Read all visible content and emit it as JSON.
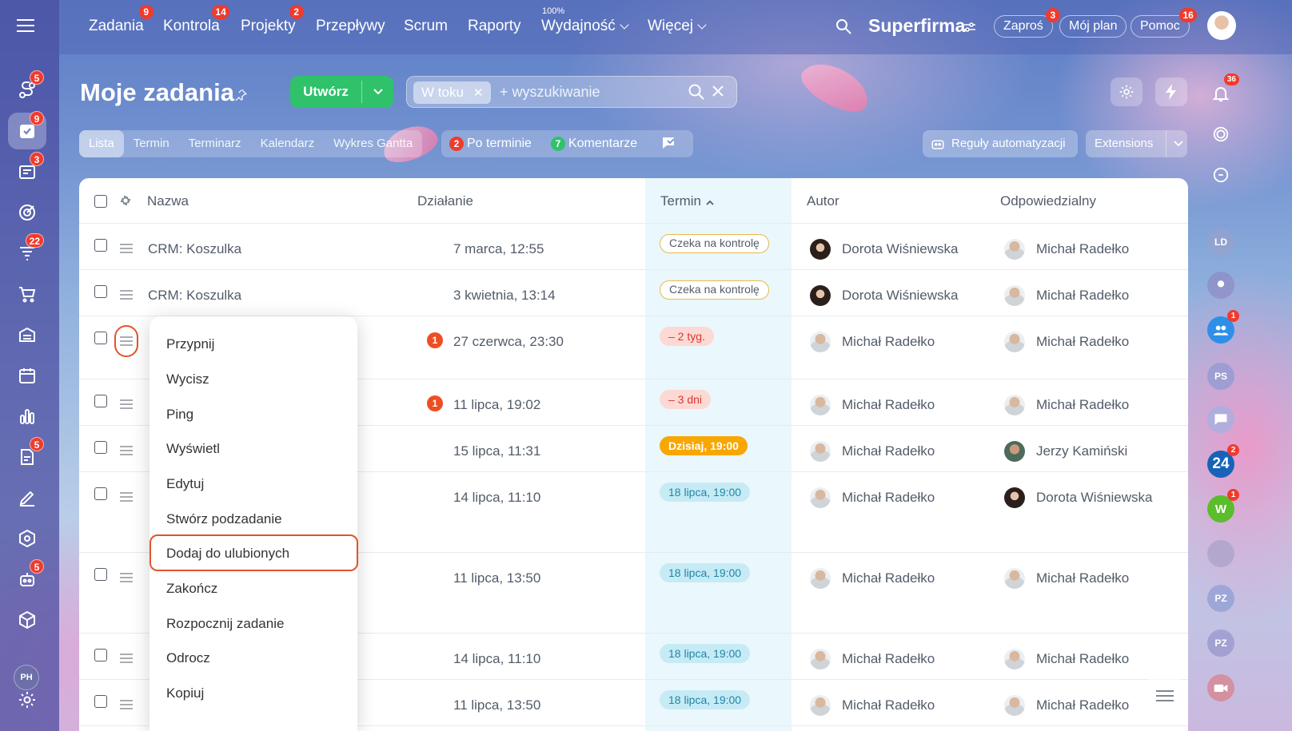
{
  "topnav": {
    "items": [
      {
        "label": "Zadania",
        "badge": "9"
      },
      {
        "label": "Kontrola",
        "badge": "14"
      },
      {
        "label": "Projekty",
        "badge": "2"
      },
      {
        "label": "Przepływy",
        "badge": ""
      },
      {
        "label": "Scrum",
        "badge": ""
      },
      {
        "label": "Raporty",
        "badge": ""
      },
      {
        "label": "Wydajność",
        "badge": "",
        "sup": "100%"
      },
      {
        "label": "Więcej",
        "badge": ""
      }
    ],
    "brand": "Superfirma",
    "invite": {
      "label": "Zaproś",
      "badge": "3"
    },
    "my_plan": "Mój plan",
    "help": {
      "label": "Pomoc",
      "badge": "16"
    }
  },
  "leftbar": {
    "badges": {
      "flows": "5",
      "tasks": "9",
      "feed": "3",
      "crm": "22",
      "docs": "5",
      "robot": "5"
    },
    "avatar_initials": "PH"
  },
  "rightbar": {
    "bell_badge": "36",
    "items": [
      {
        "initials": "LD"
      },
      {
        "initials": "",
        "badge": ""
      },
      {
        "initials": "",
        "badge": "1"
      },
      {
        "initials": "PS"
      },
      {
        "initials": ""
      },
      {
        "initials": "24",
        "badge": "2"
      },
      {
        "initials": "W",
        "badge": "1"
      },
      {
        "initials": ""
      },
      {
        "initials": "PZ"
      },
      {
        "initials": "PZ"
      }
    ]
  },
  "page": {
    "title": "Moje zadania",
    "create_label": "Utwórz",
    "filter_chip": "W toku",
    "search_placeholder": "+ wyszukiwanie"
  },
  "views": {
    "tabs": [
      "Lista",
      "Termin",
      "Terminarz",
      "Kalendarz",
      "Wykres Gantta"
    ],
    "active": "Lista",
    "overdue": {
      "count": "2",
      "label": "Po terminie"
    },
    "comments": {
      "count": "7",
      "label": "Komentarze"
    },
    "automation_label": "Reguły automatyzacji",
    "extensions_label": "Extensions"
  },
  "colors": {
    "create_green": "#2fc26a",
    "highlight_orange": "#e2542c",
    "overdue_red": "#d9372c",
    "today_orange": "#f7a700",
    "future_blue": "#1f86a8"
  },
  "table": {
    "headers": {
      "name": "Nazwa",
      "action": "Działanie",
      "deadline": "Termin",
      "author": "Autor",
      "responsible": "Odpowiedzialny"
    },
    "rows": [
      {
        "name": "CRM: Koszulka",
        "action_date": "7 marca, 12:55",
        "alert": "",
        "status": "Czeka na kontrolę",
        "status_type": "wait",
        "author": "Dorota Wiśniewska",
        "author_av": "dark",
        "responsible": "Michał Radełko",
        "resp_av": "man"
      },
      {
        "name": "CRM: Koszulka",
        "action_date": "3 kwietnia, 13:14",
        "alert": "",
        "status": "Czeka na kontrolę",
        "status_type": "wait",
        "author": "Dorota Wiśniewska",
        "author_av": "dark",
        "responsible": "Michał Radełko",
        "resp_av": "man"
      },
      {
        "name": "",
        "action_date": "27 czerwca, 23:30",
        "alert": "1",
        "status": "– 2 tyg.",
        "status_type": "over",
        "author": "Michał Radełko",
        "author_av": "man",
        "responsible": "Michał Radełko",
        "resp_av": "man"
      },
      {
        "name": "",
        "action_date": "11 lipca, 19:02",
        "alert": "1",
        "status": "– 3 dni",
        "status_type": "over",
        "author": "Michał Radełko",
        "author_av": "man",
        "responsible": "Michał Radełko",
        "resp_av": "man"
      },
      {
        "name": "",
        "action_date": "15 lipca, 11:31",
        "alert": "",
        "status": "Dzisiaj, 19:00",
        "status_type": "today",
        "author": "Michał Radełko",
        "author_av": "man",
        "responsible": "Jerzy Kamiński",
        "resp_av": "jk"
      },
      {
        "name": "",
        "action_date": "14 lipca, 11:10",
        "alert": "",
        "status": "18 lipca, 19:00",
        "status_type": "future",
        "author": "Michał Radełko",
        "author_av": "man",
        "responsible": "Dorota Wiśniewska",
        "resp_av": "dark"
      },
      {
        "name": "",
        "action_date": "11 lipca, 13:50",
        "alert": "",
        "status": "18 lipca, 19:00",
        "status_type": "future",
        "author": "Michał Radełko",
        "author_av": "man",
        "responsible": "Michał Radełko",
        "resp_av": "man"
      },
      {
        "name": "",
        "action_date": "14 lipca, 11:10",
        "alert": "",
        "status": "18 lipca, 19:00",
        "status_type": "future",
        "author": "Michał Radełko",
        "author_av": "man",
        "responsible": "Michał Radełko",
        "resp_av": "man"
      },
      {
        "name": "",
        "action_date": "11 lipca, 13:50",
        "alert": "",
        "status": "18 lipca, 19:00",
        "status_type": "future",
        "author": "Michał Radełko",
        "author_av": "man",
        "responsible": "Michał Radełko",
        "resp_av": "man"
      }
    ]
  },
  "context_menu": {
    "items": [
      "Przypnij",
      "Wycisz",
      "Ping",
      "Wyświetl",
      "Edytuj",
      "Stwórz podzadanie",
      "Dodaj do ulubionych",
      "Zakończ",
      "Rozpocznij zadanie",
      "Odrocz",
      "Kopiuj"
    ],
    "highlighted": "Dodaj do ulubionych"
  }
}
